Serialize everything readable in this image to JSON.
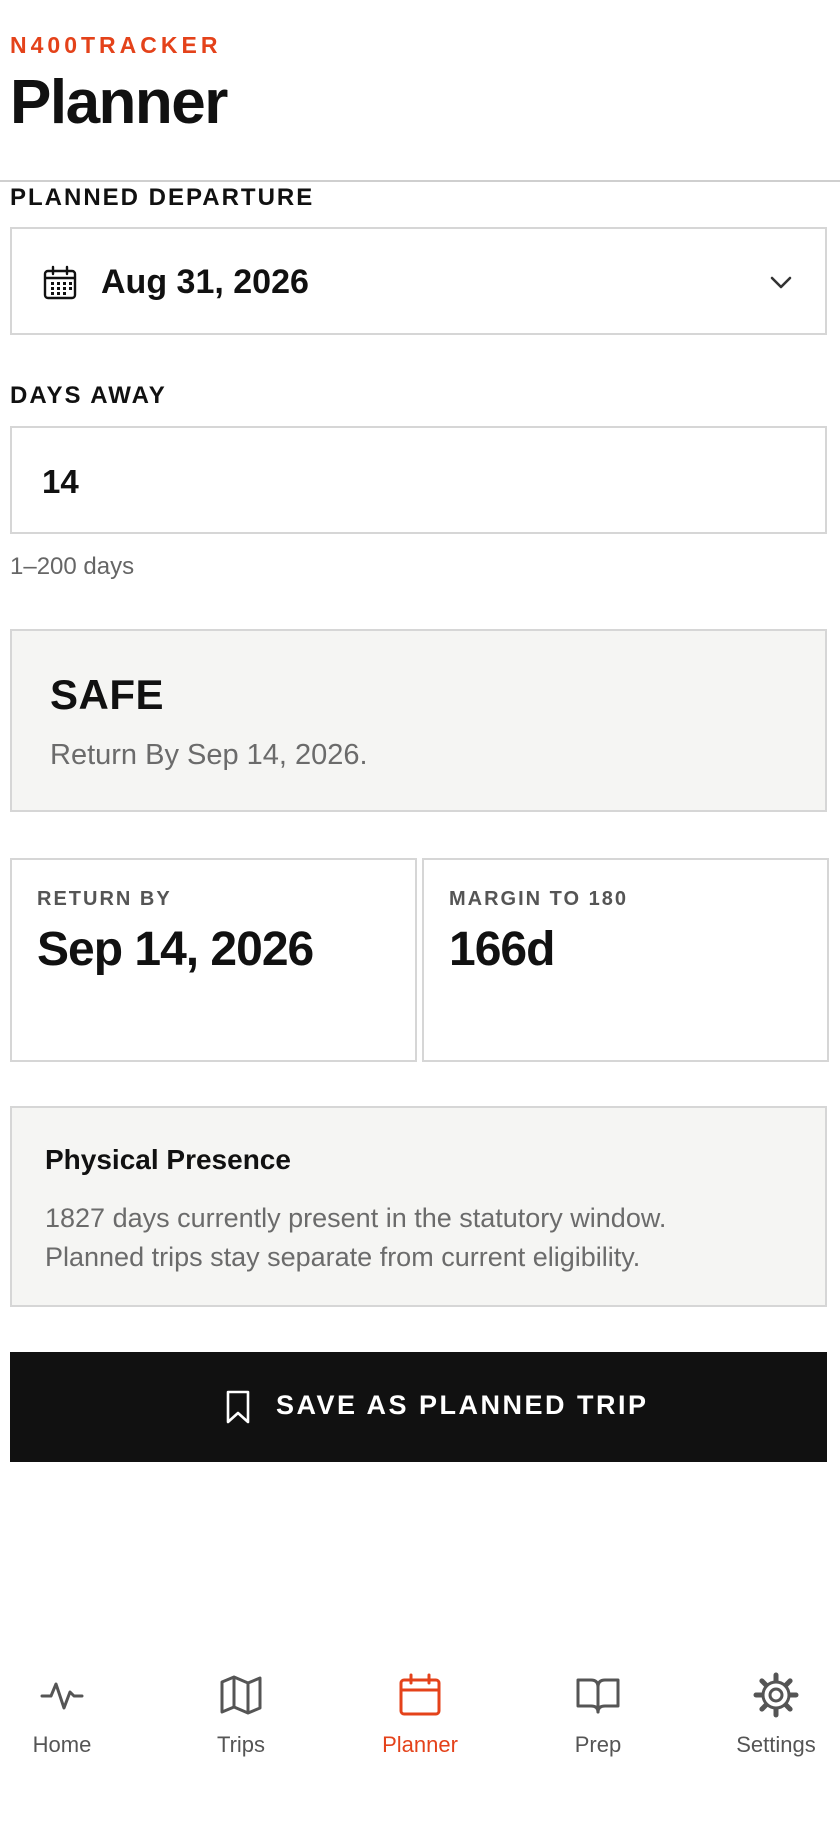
{
  "header": {
    "brand": "N400TRACKER",
    "title": "Planner"
  },
  "departure": {
    "label": "PLANNED DEPARTURE",
    "value": "Aug 31, 2026",
    "icon": "calendar-icon"
  },
  "days_away": {
    "label": "DAYS AWAY",
    "value": "14",
    "helper": "1–200 days"
  },
  "status": {
    "title": "SAFE",
    "subtitle": "Return By Sep 14, 2026."
  },
  "stats": [
    {
      "label": "RETURN BY",
      "value": "Sep 14, 2026"
    },
    {
      "label": "MARGIN TO 180",
      "value": "166d"
    }
  ],
  "presence": {
    "title": "Physical Presence",
    "line1": "1827 days currently present in the statutory window.",
    "line2": "Planned trips stay separate from current eligibility."
  },
  "save_button": {
    "label": "SAVE AS PLANNED TRIP",
    "icon": "bookmark-icon"
  },
  "nav": {
    "active": "Planner",
    "items": [
      {
        "label": "Home",
        "icon": "activity-icon"
      },
      {
        "label": "Trips",
        "icon": "map-icon"
      },
      {
        "label": "Planner",
        "icon": "calendar-icon"
      },
      {
        "label": "Prep",
        "icon": "book-icon"
      },
      {
        "label": "Settings",
        "icon": "gear-icon"
      }
    ]
  },
  "colors": {
    "accent": "#e4421a",
    "text": "#111111",
    "muted": "#6b6b6b",
    "border": "#d6d6d6",
    "card_bg": "#f5f5f3",
    "button_bg": "#111111"
  }
}
